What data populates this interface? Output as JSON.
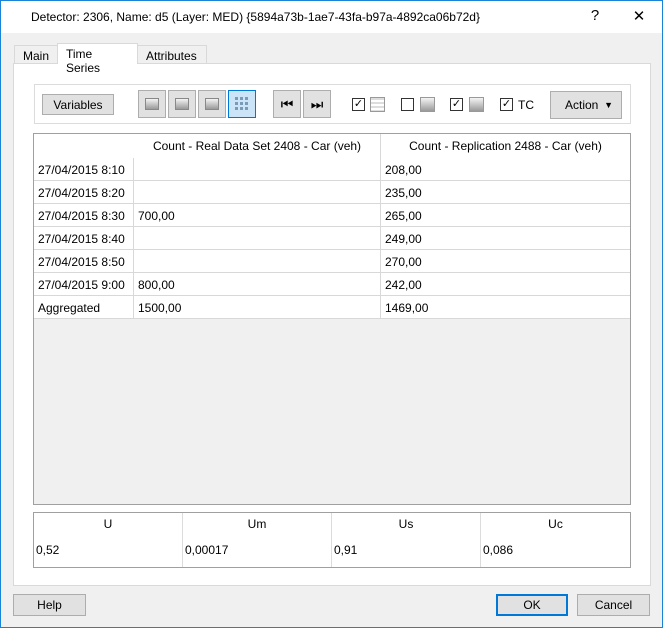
{
  "window": {
    "title": "Detector: 2306, Name: d5 (Layer: MED) {5894a73b-1ae7-43fa-b97a-4892ca06b72d}",
    "help_glyph": "?",
    "close_glyph": "✕"
  },
  "tabs": [
    {
      "label": "Main"
    },
    {
      "label": "Time Series",
      "active": true
    },
    {
      "label": "Attributes"
    }
  ],
  "toolbar": {
    "variables_label": "Variables",
    "tc_label": "TC",
    "action_label": "Action",
    "checks": {
      "calendar": true,
      "chart1": false,
      "chart2": true,
      "tc": true
    }
  },
  "table": {
    "columns": [
      "Count - Real Data Set 2408 - Car (veh)",
      "Count - Replication 2488 - Car (veh)"
    ],
    "rows": [
      {
        "label": "27/04/2015 8:10",
        "c1": "",
        "c2": "208,00"
      },
      {
        "label": "27/04/2015 8:20",
        "c1": "",
        "c2": "235,00"
      },
      {
        "label": "27/04/2015 8:30",
        "c1": "700,00",
        "c2": "265,00"
      },
      {
        "label": "27/04/2015 8:40",
        "c1": "",
        "c2": "249,00"
      },
      {
        "label": "27/04/2015 8:50",
        "c1": "",
        "c2": "270,00"
      },
      {
        "label": "27/04/2015 9:00",
        "c1": "800,00",
        "c2": "242,00"
      },
      {
        "label": "Aggregated",
        "c1": "1500,00",
        "c2": "1469,00"
      }
    ]
  },
  "stats": [
    {
      "h": "U",
      "v": "0,52"
    },
    {
      "h": "Um",
      "v": "0,00017"
    },
    {
      "h": "Us",
      "v": "0,91"
    },
    {
      "h": "Uc",
      "v": "0,086"
    }
  ],
  "footer": {
    "help": "Help",
    "ok": "OK",
    "cancel": "Cancel"
  },
  "colors": {
    "accent": "#0078d7",
    "border": "#1883d7"
  }
}
